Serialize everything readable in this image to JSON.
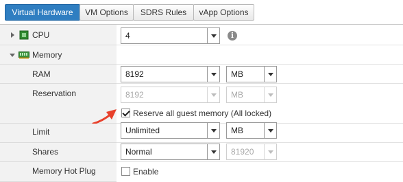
{
  "tabs": [
    {
      "label": "Virtual Hardware",
      "active": true
    },
    {
      "label": "VM Options",
      "active": false
    },
    {
      "label": "SDRS Rules",
      "active": false
    },
    {
      "label": "vApp Options",
      "active": false
    }
  ],
  "cpu": {
    "label": "CPU",
    "value": "4",
    "icon": "cpu-chip-icon",
    "info_icon": "info-icon"
  },
  "memory": {
    "label": "Memory",
    "icon": "memory-module-icon",
    "ram": {
      "label": "RAM",
      "value": "8192",
      "unit": "MB"
    },
    "reservation": {
      "label": "Reservation",
      "value": "8192",
      "unit": "MB",
      "disabled": true
    },
    "reserve_all": {
      "label": "Reserve all guest memory (All locked)",
      "checked": true
    },
    "limit": {
      "label": "Limit",
      "value": "Unlimited",
      "unit": "MB"
    },
    "shares": {
      "label": "Shares",
      "value": "Normal",
      "amount": "81920"
    },
    "hot_plug": {
      "label": "Memory Hot Plug",
      "enable_label": "Enable",
      "checked": false
    }
  },
  "colors": {
    "active_tab": "#2f7ec1",
    "annotation_arrow": "#e8412c"
  }
}
